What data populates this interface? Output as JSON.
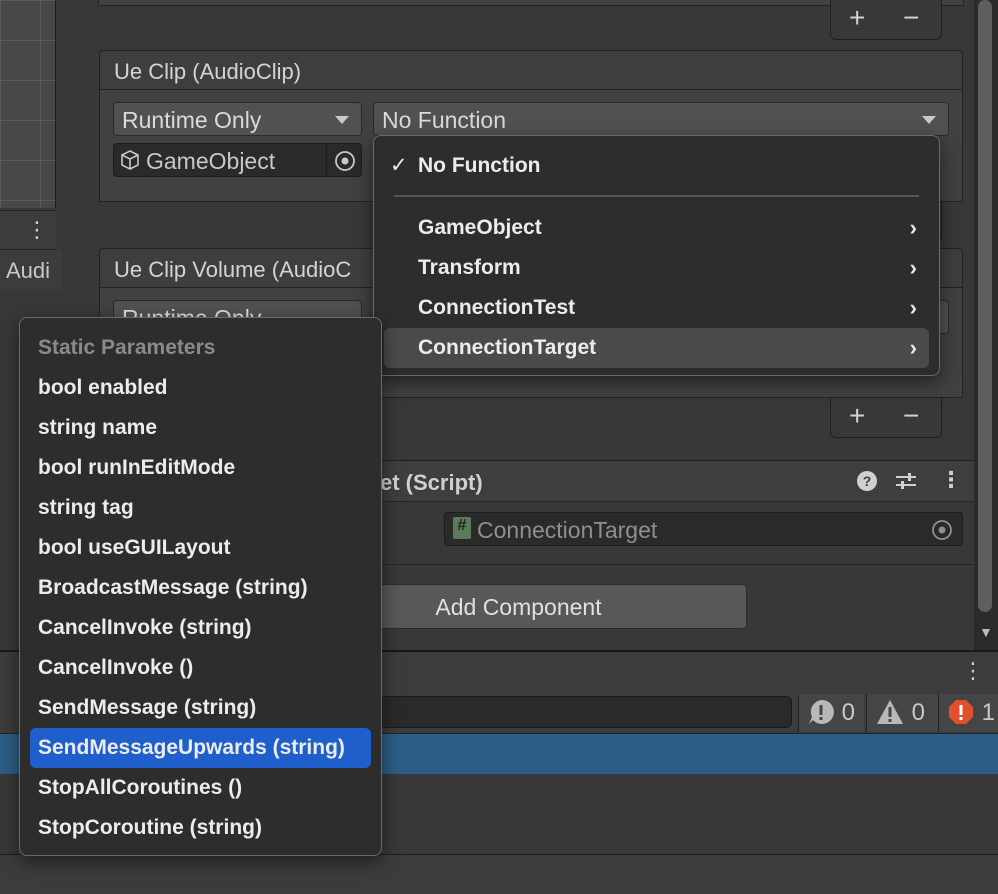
{
  "left_panel": {
    "audio_tab_label": "Audi"
  },
  "events": [
    {
      "header": "Ue Clip (AudioClip)",
      "mode": "Runtime Only",
      "function": "No Function",
      "object": "GameObject"
    },
    {
      "header": "Ue Clip Volume (AudioC",
      "mode": "Runtime Only"
    }
  ],
  "plus_minus": {
    "plus": "+",
    "minus": "−"
  },
  "component": {
    "title_fragment": "et (Script)",
    "script_field": "ConnectionTarget",
    "add_component_label": "Add Component"
  },
  "function_menu": {
    "check": "✓",
    "selected_label": "No Function",
    "items": [
      "GameObject",
      "Transform",
      "ConnectionTest",
      "ConnectionTarget"
    ]
  },
  "params_menu": {
    "header": "Static Parameters",
    "items": [
      "bool enabled",
      "string name",
      "bool runInEditMode",
      "string tag",
      "bool useGUILayout",
      "BroadcastMessage (string)",
      "CancelInvoke (string)",
      "CancelInvoke ()",
      "SendMessage (string)",
      "SendMessageUpwards (string)",
      "StopAllCoroutines ()",
      "StopCoroutine (string)"
    ],
    "selected_index": 9
  },
  "console": {
    "info_count": "0",
    "warning_count": "0",
    "error_count": "1"
  },
  "colors": {
    "selection_blue": "#1f5fcc",
    "console_selection": "#2c5d87",
    "error_red": "#e0502e"
  }
}
